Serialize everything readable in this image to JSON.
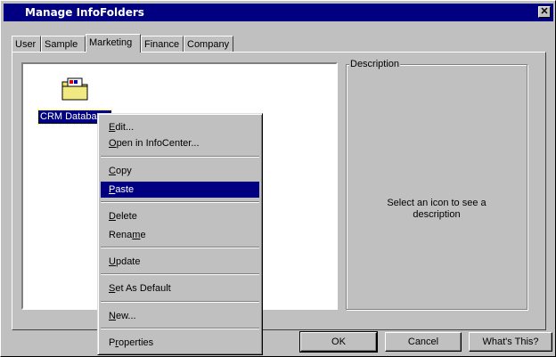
{
  "window": {
    "title": "Manage InfoFolders",
    "close_glyph": "✕"
  },
  "tabs": [
    {
      "label": "User"
    },
    {
      "label": "Sample"
    },
    {
      "label": "Marketing",
      "active": true
    },
    {
      "label": "Finance"
    },
    {
      "label": "Company"
    }
  ],
  "list": {
    "items": [
      {
        "label": "CRM Databa",
        "icon": "folder-icon",
        "selected": true
      }
    ]
  },
  "description": {
    "legend": "Description",
    "line1": "Select an icon to see a",
    "line2": "description"
  },
  "context_menu": {
    "items": [
      {
        "label": "Edit...",
        "accel": "E",
        "rest": "dit..."
      },
      {
        "label": "Open in InfoCenter...",
        "accel": "O",
        "rest": "pen in InfoCenter..."
      },
      {
        "label": "Copy",
        "accel": "C",
        "rest": "opy"
      },
      {
        "label": "Paste",
        "accel": "P",
        "rest": "aste",
        "selected": true
      },
      {
        "label": "Delete",
        "accel": "D",
        "rest": "elete"
      },
      {
        "label": "Rename",
        "pre": "Rena",
        "accel": "m",
        "rest": "e"
      },
      {
        "label": "Update",
        "accel": "U",
        "rest": "pdate"
      },
      {
        "label": "Set As Default",
        "accel": "S",
        "rest": "et As Default"
      },
      {
        "label": "New...",
        "accel": "N",
        "rest": "ew..."
      },
      {
        "label": "Properties",
        "pre": "P",
        "accel": "r",
        "rest": "operties"
      }
    ]
  },
  "buttons": {
    "ok": "OK",
    "cancel": "Cancel",
    "help": "What's This?"
  },
  "colors": {
    "titlebar": "#000080",
    "face": "#c0c0c0",
    "highlight": "#000080"
  }
}
